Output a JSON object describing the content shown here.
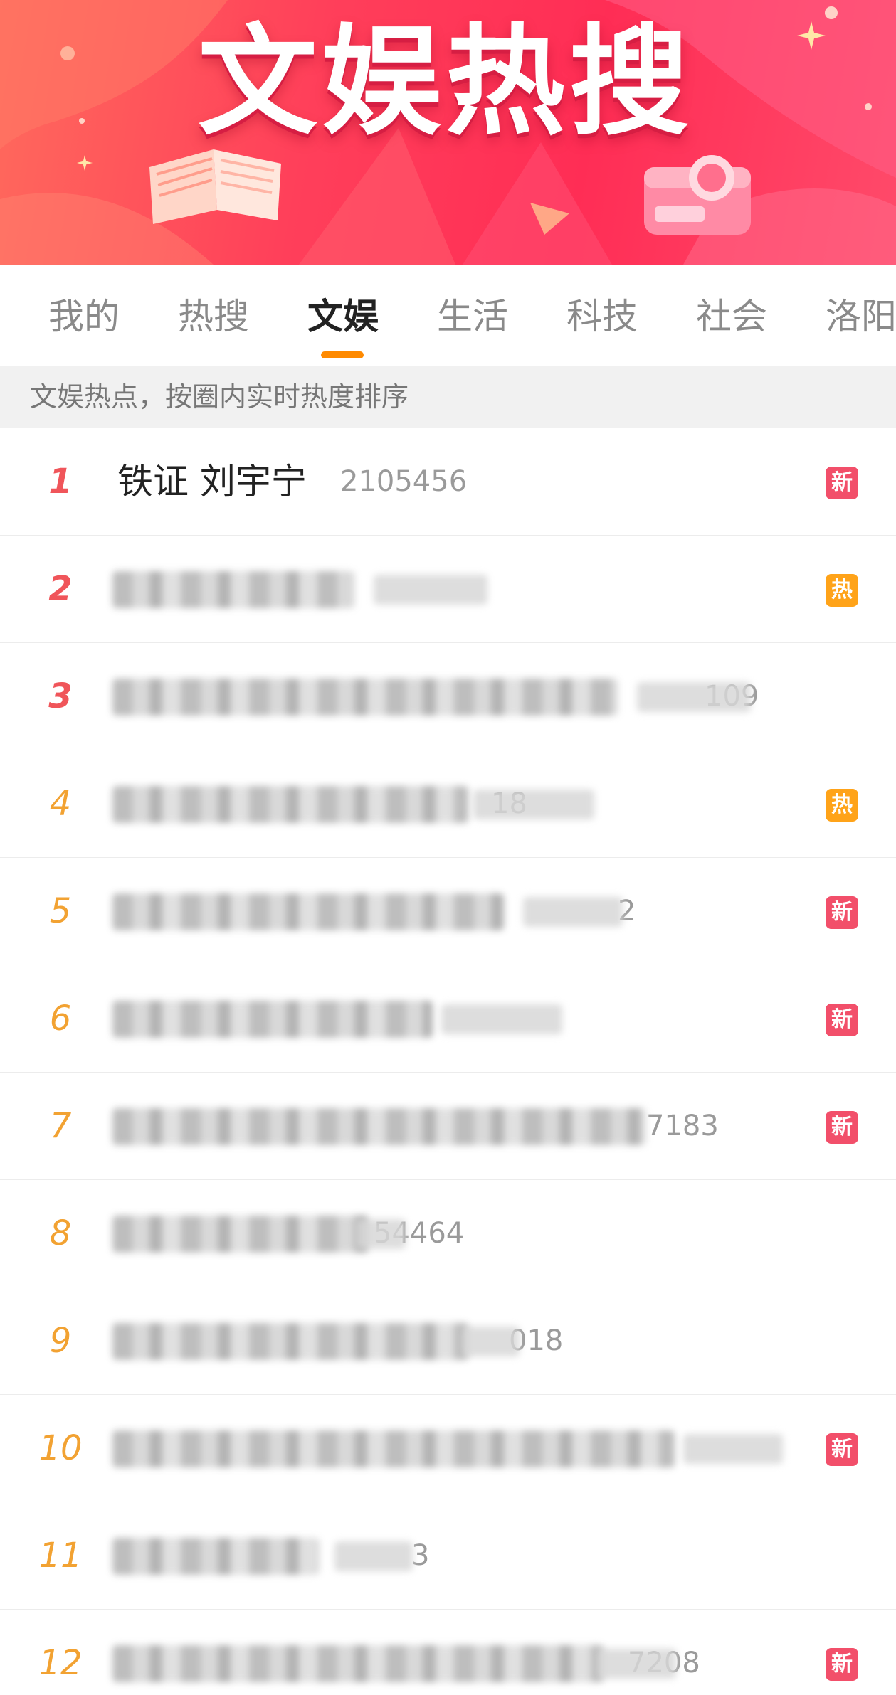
{
  "banner": {
    "title": "文娱热搜"
  },
  "tabs": [
    {
      "label": "我的"
    },
    {
      "label": "热搜"
    },
    {
      "label": "文娱",
      "active": true
    },
    {
      "label": "生活"
    },
    {
      "label": "科技"
    },
    {
      "label": "社会"
    },
    {
      "label": "洛阳"
    }
  ],
  "subtitle": "文娱热点，按圈内实时热度排序",
  "list": [
    {
      "rank": "1",
      "topic": "铁证 刘宇宁",
      "heat": "2105456",
      "badge": "新"
    },
    {
      "rank": "2",
      "topic": "",
      "heat": "",
      "badge": "热"
    },
    {
      "rank": "3",
      "topic": "",
      "heat": "109",
      "badge": ""
    },
    {
      "rank": "4",
      "topic": "",
      "heat": "18",
      "badge": "热"
    },
    {
      "rank": "5",
      "topic": "",
      "heat": "2",
      "badge": "新"
    },
    {
      "rank": "6",
      "topic": "",
      "heat": "",
      "badge": "新"
    },
    {
      "rank": "7",
      "topic": "",
      "heat": "7183",
      "badge": "新"
    },
    {
      "rank": "8",
      "topic": "",
      "heat": "54464",
      "badge": ""
    },
    {
      "rank": "9",
      "topic": "",
      "heat": "018",
      "badge": ""
    },
    {
      "rank": "10",
      "topic": "",
      "heat": "",
      "badge": "新"
    },
    {
      "rank": "11",
      "topic": "",
      "heat": "3",
      "badge": ""
    },
    {
      "rank": "12",
      "topic": "",
      "heat": "7208",
      "badge": "新"
    }
  ],
  "colors": {
    "banner_red": "#ff3f5a",
    "tab_indicator": "#ff8a00",
    "rank_top": "#f0555a",
    "rank_other": "#f2a232",
    "badge_new": "#f24f6a",
    "badge_hot": "#ffa319"
  },
  "icons": [
    "open-book-icon",
    "camera-icon",
    "sparkle-icon"
  ]
}
